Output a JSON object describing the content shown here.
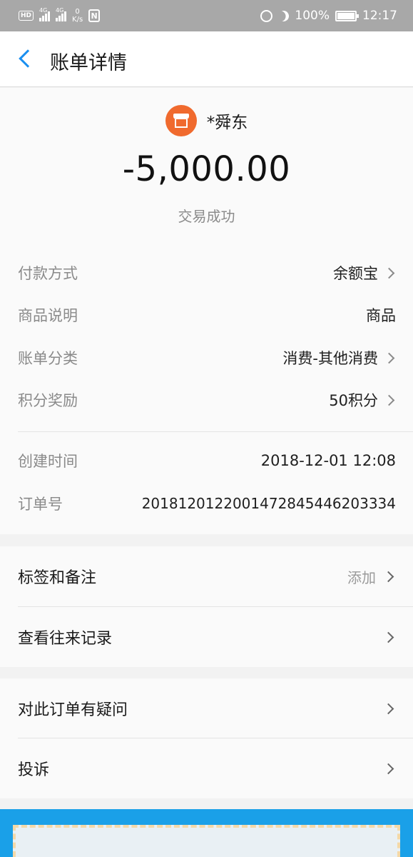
{
  "status_bar": {
    "hd": "HD",
    "net1": "4G",
    "net2": "4G",
    "speed_value": "0",
    "speed_unit": "K/s",
    "nfc": "N",
    "battery": "100%",
    "time": "12:17"
  },
  "header": {
    "title": "账单详情"
  },
  "bill": {
    "merchant": "*舜东",
    "amount": "-5,000.00",
    "status": "交易成功",
    "rows": [
      {
        "label": "付款方式",
        "value": "余额宝"
      },
      {
        "label": "商品说明",
        "value": "商品"
      },
      {
        "label": "账单分类",
        "value": "消费-其他消费"
      },
      {
        "label": "积分奖励",
        "value": "50积分"
      },
      {
        "label": "创建时间",
        "value": "2018-12-01 12:08"
      },
      {
        "label": "订单号",
        "value": "2018120122001472845446203334"
      }
    ]
  },
  "actions": {
    "tags_label": "标签和备注",
    "tags_hint": "添加",
    "history_label": "查看往来记录",
    "question_label": "对此订单有疑问",
    "complaint_label": "投诉"
  },
  "colors": {
    "accent": "#1a8ff0",
    "merchant_icon": "#f06a2e",
    "banner": "#1aa0e8"
  }
}
